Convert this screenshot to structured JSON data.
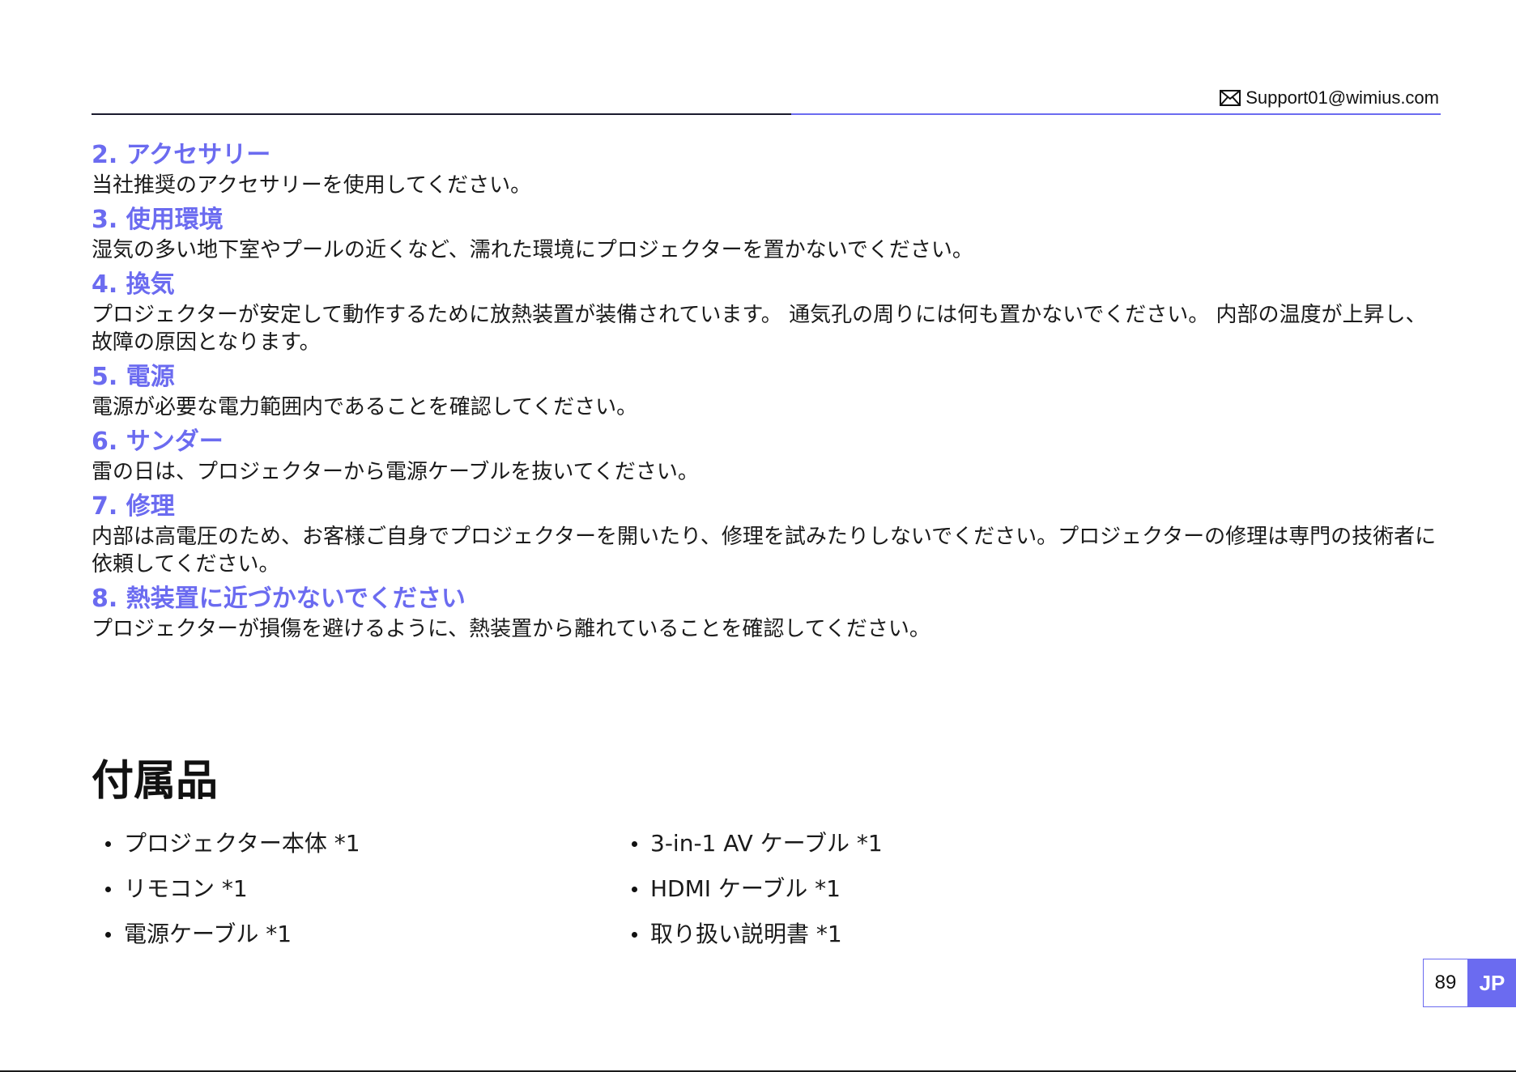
{
  "header": {
    "email": "Support01@wimius.com"
  },
  "sections": [
    {
      "heading": "2. アクセサリー",
      "body": "当社推奨のアクセサリーを使用してください。"
    },
    {
      "heading": "3. 使用環境",
      "body": "湿気の多い地下室やプールの近くなど、濡れた環境にプロジェクターを置かないでください。"
    },
    {
      "heading": "4. 換気",
      "body": "プロジェクターが安定して動作するために放熱装置が装備されています。 通気孔の周りには何も置かないでください。 内部の温度が上昇し、故障の原因となります。"
    },
    {
      "heading": "5. 電源",
      "body": "電源が必要な電力範囲内であることを確認してください。"
    },
    {
      "heading": "6. サンダー",
      "body": "雷の日は、プロジェクターから電源ケーブルを抜いてください。"
    },
    {
      "heading": "7. 修理",
      "body": "内部は高電圧のため、お客様ご自身でプロジェクターを開いたり、修理を試みたりしないでください。プロジェクターの修理は専門の技術者に依頼してください。"
    },
    {
      "heading": "8. 熱装置に近づかないでください",
      "body": "プロジェクターが損傷を避けるように、熱装置から離れていることを確認してください。"
    }
  ],
  "accessories": {
    "title": "付属品",
    "items": [
      "プロジェクター本体 *1",
      "3-in-1 AV ケーブル *1",
      "リモコン *1",
      "HDMI ケーブル *1",
      "電源ケーブル *1",
      "取り扱い説明書 *1"
    ]
  },
  "footer": {
    "page_number": "89",
    "language": "JP"
  },
  "colors": {
    "accent": "#6b6bf0",
    "text": "#1a1a1a"
  }
}
